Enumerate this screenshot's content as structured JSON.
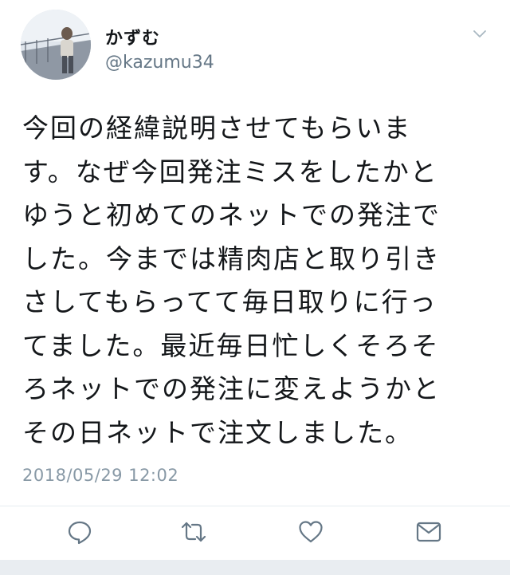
{
  "user": {
    "display_name": "かずむ",
    "handle": "@kazumu34"
  },
  "tweet": {
    "lines": [
      "今回の経緯説明させてもらいま",
      "す。なぜ今回発注ミスをしたかと",
      "ゆうと初めてのネットでの発注で",
      "した。今までは精肉店と取り引き",
      "さしてもらってて毎日取りに行っ",
      "てました。最近毎日忙しくそろそ",
      "ろネットでの発注に変えようかと",
      "その日ネットで注文しました。"
    ],
    "timestamp": "2018/05/29 12:02"
  },
  "actions": {
    "icons": [
      "reply-icon",
      "retweet-icon",
      "like-icon",
      "direct-message-icon"
    ]
  },
  "colors": {
    "text": "#14171a",
    "secondary": "#657786",
    "timestamp": "#8899a6",
    "icon": "#657786",
    "divider": "#e6ecf0"
  }
}
